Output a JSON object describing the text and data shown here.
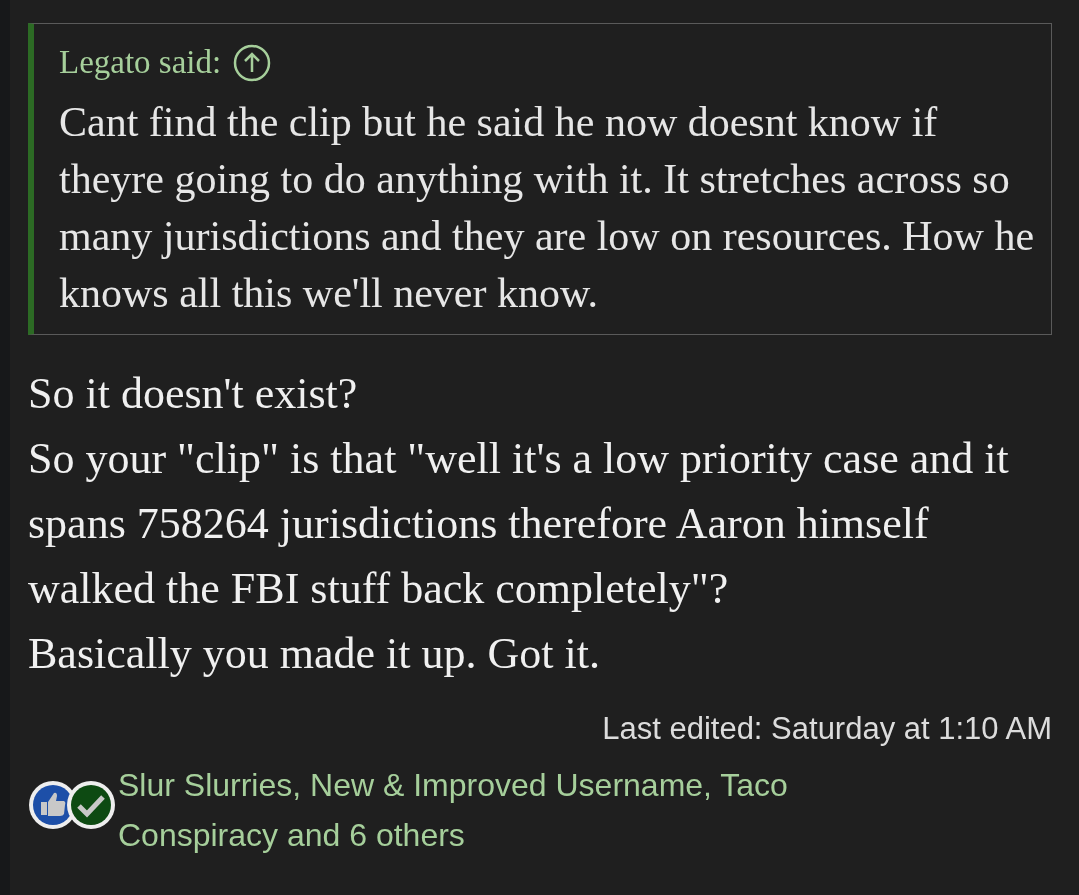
{
  "quote": {
    "author_label": "Legato said:",
    "text": "Cant find the clip but he said he now doesnt know if theyre going to do anything with it. It stretches across so many jurisdictions and they are low on resources. How he knows all this we'll never know."
  },
  "body": [
    "So it doesn't exist?",
    "So your \"clip\" is that \"well it's a low priority case and it spans 758264 jurisdictions therefore Aaron himself walked the FBI stuff back completely\"?",
    "Basically you made it up. Got it."
  ],
  "last_edited": "Last edited: Saturday at 1:10 AM",
  "reactions": {
    "icons": [
      {
        "kind": "like"
      },
      {
        "kind": "agree"
      }
    ],
    "text": "Slur Slurries, New & Improved Username, Taco Conspiracy and 6 others"
  }
}
